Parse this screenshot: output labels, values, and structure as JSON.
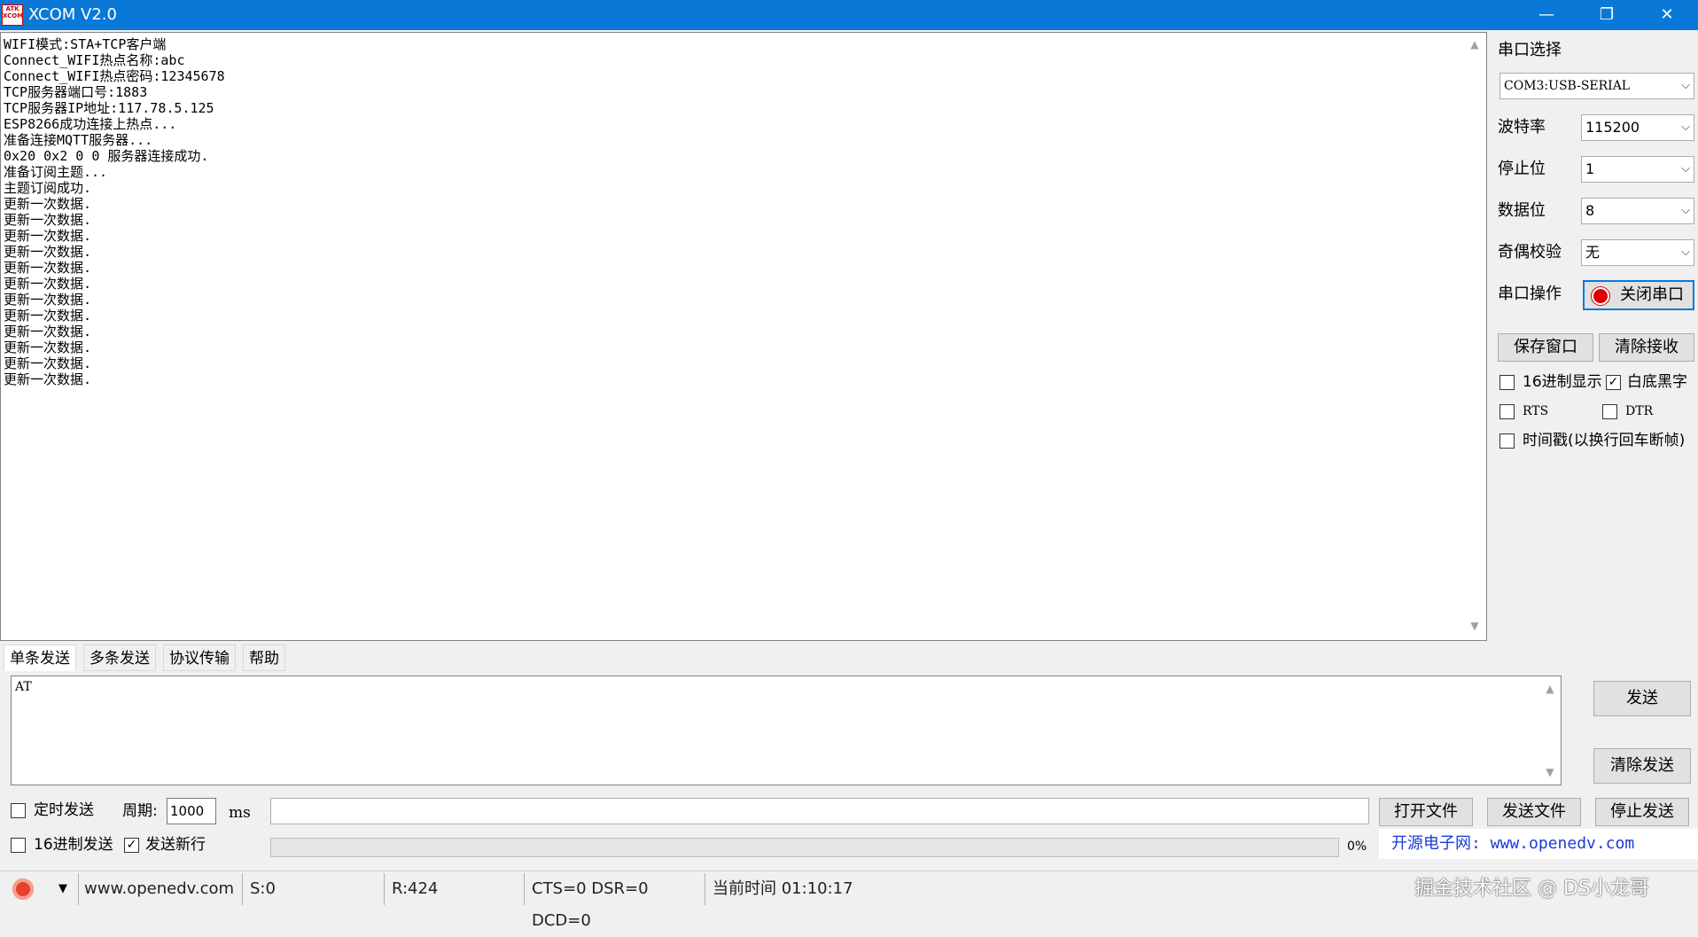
{
  "titlebar": {
    "app_icon_text": "ATK XCOM",
    "title": "XCOM V2.0",
    "minimize": "—",
    "restore": "❐",
    "close": "✕"
  },
  "receive": {
    "lines": [
      "WIFI模式:STA+TCP客户端",
      "Connect_WIFI热点名称:abc",
      "Connect_WIFI热点密码:12345678",
      "TCP服务器端口号:1883",
      "TCP服务器IP地址:117.78.5.125",
      "ESP8266成功连接上热点...",
      "准备连接MQTT服务器...",
      "0x20 0x2 0 0 服务器连接成功.",
      "准备订阅主题...",
      "主题订阅成功.",
      "更新一次数据.",
      "更新一次数据.",
      "更新一次数据.",
      "更新一次数据.",
      "更新一次数据.",
      "更新一次数据.",
      "更新一次数据.",
      "更新一次数据.",
      "更新一次数据.",
      "更新一次数据.",
      "更新一次数据.",
      "更新一次数据."
    ]
  },
  "settings": {
    "port_select_label": "串口选择",
    "port_value": "COM3:USB-SERIAL",
    "baud_label": "波特率",
    "baud_value": "115200",
    "stopbit_label": "停止位",
    "stopbit_value": "1",
    "databit_label": "数据位",
    "databit_value": "8",
    "parity_label": "奇偶校验",
    "parity_value": "无",
    "port_op_label": "串口操作",
    "close_port_button": "关闭串口",
    "save_window_button": "保存窗口",
    "clear_receive_button": "清除接收",
    "hex_display_label": "16进制显示",
    "hex_display_checked": false,
    "white_bg_label": "白底黑字",
    "white_bg_checked": true,
    "rts_label": "RTS",
    "rts_checked": false,
    "dtr_label": "DTR",
    "dtr_checked": false,
    "timestamp_label": "时间戳(以换行回车断帧)",
    "timestamp_checked": false,
    "status_color": "#e00000"
  },
  "tabs": [
    {
      "label": "单条发送",
      "active": true
    },
    {
      "label": "多条发送",
      "active": false
    },
    {
      "label": "协议传输",
      "active": false
    },
    {
      "label": "帮助",
      "active": false
    }
  ],
  "send": {
    "text": "AT",
    "send_button": "发送",
    "clear_send_button": "清除发送",
    "timed_send_label": "定时发送",
    "timed_send_checked": false,
    "period_label": "周期:",
    "period_value": "1000",
    "period_unit": "ms",
    "hex_send_label": "16进制发送",
    "hex_send_checked": false,
    "newline_label": "发送新行",
    "newline_checked": true,
    "open_file_button": "打开文件",
    "send_file_button": "发送文件",
    "stop_send_button": "停止发送",
    "progress_percent": "0%",
    "site_banner": "开源电子网: www.openedv.com"
  },
  "statusbar": {
    "website": "www.openedv.com",
    "sent": "S:0",
    "received": "R:424",
    "signals": "CTS=0 DSR=0 DCD=0",
    "time": "当前时间 01:10:17",
    "watermark": "掘金技术社区 @ DS小龙哥"
  }
}
